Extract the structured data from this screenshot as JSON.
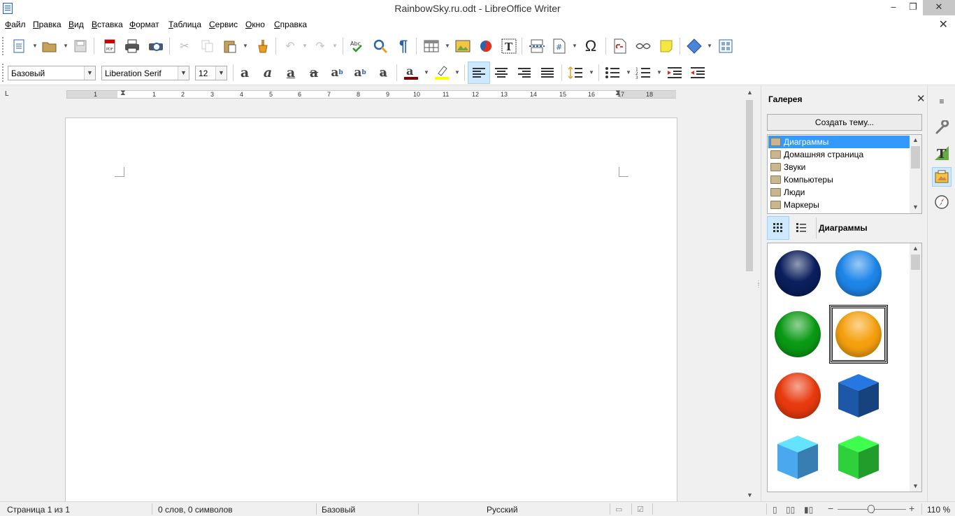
{
  "window": {
    "title": "RainbowSky.ru.odt - LibreOffice Writer",
    "minimize": "‒",
    "maximize": "❐",
    "close": "✕"
  },
  "menu": [
    "Файл",
    "Правка",
    "Вид",
    "Вставка",
    "Формат",
    "Таблица",
    "Сервис",
    "Окно",
    "Справка"
  ],
  "doc_close": "✕",
  "toolbar": {
    "style": "Базовый",
    "font": "Liberation Serif",
    "size": "12"
  },
  "ruler": {
    "numbers": [
      "1",
      "1",
      "2",
      "3",
      "4",
      "5",
      "6",
      "7",
      "8",
      "9",
      "10",
      "11",
      "12",
      "13",
      "14",
      "15",
      "16",
      "17",
      "18"
    ]
  },
  "sidebar": {
    "title": "Галерея",
    "close": "✕",
    "create_theme": "Создать тему...",
    "themes": [
      "Диаграммы",
      "Домашняя страница",
      "Звуки",
      "Компьютеры",
      "Люди",
      "Маркеры"
    ],
    "selected_theme_index": 0,
    "view_title": "Диаграммы",
    "gallery_items": [
      {
        "name": "dark-blue-ball",
        "color": "#0a1f5c"
      },
      {
        "name": "blue-ball",
        "color": "#1e86e8"
      },
      {
        "name": "green-ball",
        "color": "#0a9a15"
      },
      {
        "name": "orange-ball",
        "color": "#f5a00e"
      },
      {
        "name": "red-ball",
        "color": "#e83a0e"
      },
      {
        "name": "dark-blue-cube",
        "color": "#1d58a8"
      },
      {
        "name": "light-blue-cube",
        "color": "#4aa8ef"
      },
      {
        "name": "green-cube",
        "color": "#2ed13a"
      }
    ],
    "selected_gallery_index": 3
  },
  "status": {
    "page": "Страница 1 из 1",
    "words": "0 слов, 0 символов",
    "style": "Базовый",
    "language": "Русский",
    "zoom": "110 %"
  }
}
